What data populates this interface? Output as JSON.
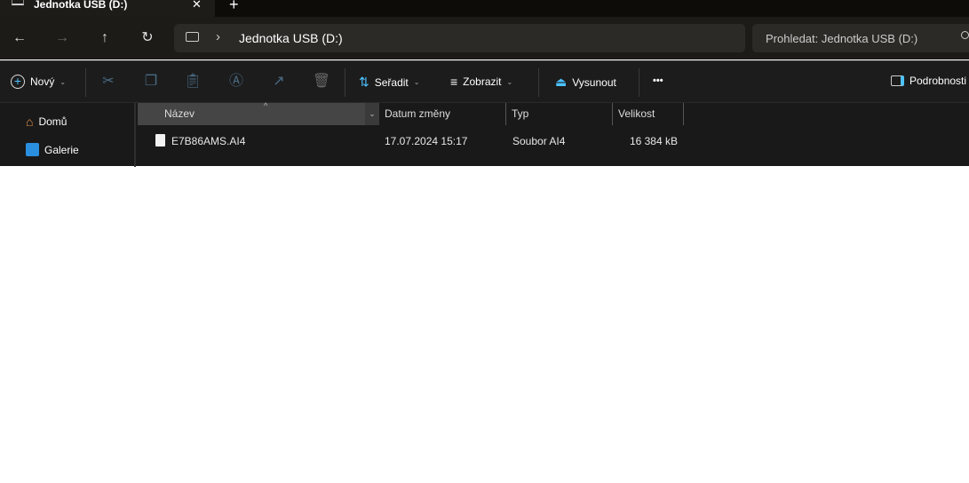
{
  "tab": {
    "title": "Jednotka USB (D:)",
    "close": "✕",
    "new_tab": "+"
  },
  "nav": {
    "back": "←",
    "forward": "→",
    "up": "↑",
    "refresh": "↻",
    "chevron": "›",
    "path": "Jednotka USB (D:)",
    "search_placeholder": "Prohledat: Jednotka USB (D:)"
  },
  "toolbar": {
    "new": "Nový",
    "sort": "Seřadit",
    "view": "Zobrazit",
    "eject": "Vysunout",
    "more": "•••",
    "details": "Podrobnosti"
  },
  "sidebar": {
    "items": [
      {
        "label": "Domů",
        "icon": "home-icon"
      },
      {
        "label": "Galerie",
        "icon": "gallery-icon"
      }
    ]
  },
  "columns": [
    "Název",
    "Datum změny",
    "Typ",
    "Velikost"
  ],
  "files": [
    {
      "name": "E7B86AMS.AI4",
      "modified": "17.07.2024 15:17",
      "type": "Soubor AI4",
      "size": "16 384 kB"
    }
  ],
  "colors": {
    "accent": "#4cc2ff",
    "dark": "#1c1c1c"
  }
}
